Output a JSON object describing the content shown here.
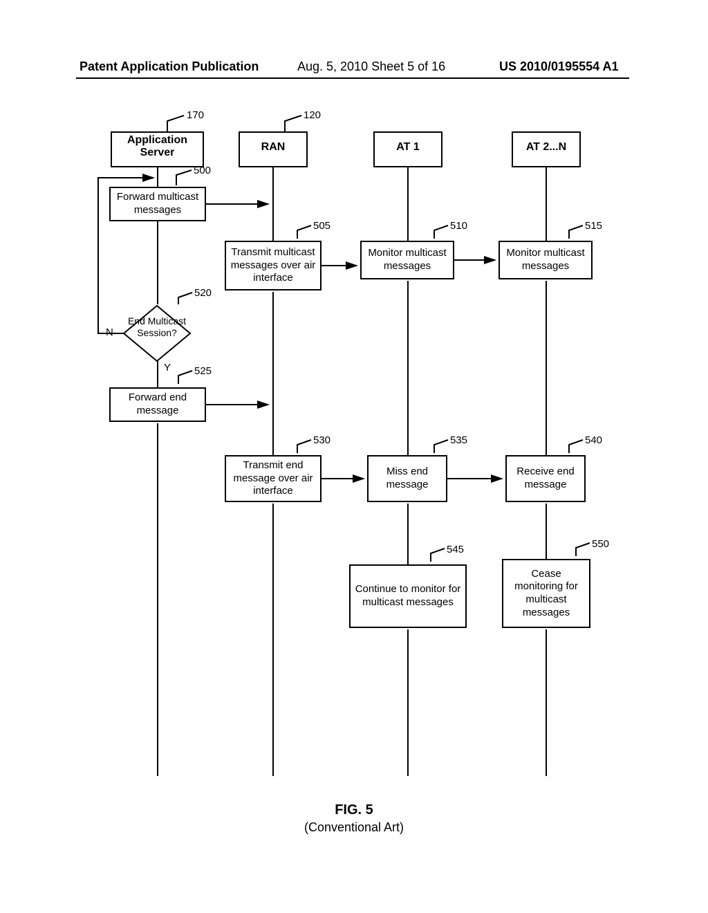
{
  "header": {
    "left": "Patent Application Publication",
    "center": "Aug. 5, 2010  Sheet 5 of 16",
    "right": "US 2010/0195554 A1"
  },
  "lanes": {
    "appServer": {
      "label": "Application Server",
      "ref": "170"
    },
    "ran": {
      "label": "RAN",
      "ref": "120"
    },
    "at1": {
      "label": "AT 1"
    },
    "atN": {
      "label": "AT 2...N"
    }
  },
  "nodes": {
    "n500": {
      "label": "Forward multicast messages",
      "ref": "500"
    },
    "n505": {
      "label": "Transmit multicast messages over air interface",
      "ref": "505"
    },
    "n510": {
      "label": "Monitor multicast messages",
      "ref": "510"
    },
    "n515": {
      "label": "Monitor multicast messages",
      "ref": "515"
    },
    "n520": {
      "label": "End Multicast Session?",
      "ref": "520",
      "branchN": "N",
      "branchY": "Y"
    },
    "n525": {
      "label": "Forward end message",
      "ref": "525"
    },
    "n530": {
      "label": "Transmit end message over air interface",
      "ref": "530"
    },
    "n535": {
      "label": "Miss end message",
      "ref": "535"
    },
    "n540": {
      "label": "Receive end message",
      "ref": "540"
    },
    "n545": {
      "label": "Continue to monitor for multicast messages",
      "ref": "545"
    },
    "n550": {
      "label": "Cease monitoring for multicast messages",
      "ref": "550"
    }
  },
  "figure": {
    "title": "FIG. 5",
    "subtitle": "(Conventional Art)"
  }
}
